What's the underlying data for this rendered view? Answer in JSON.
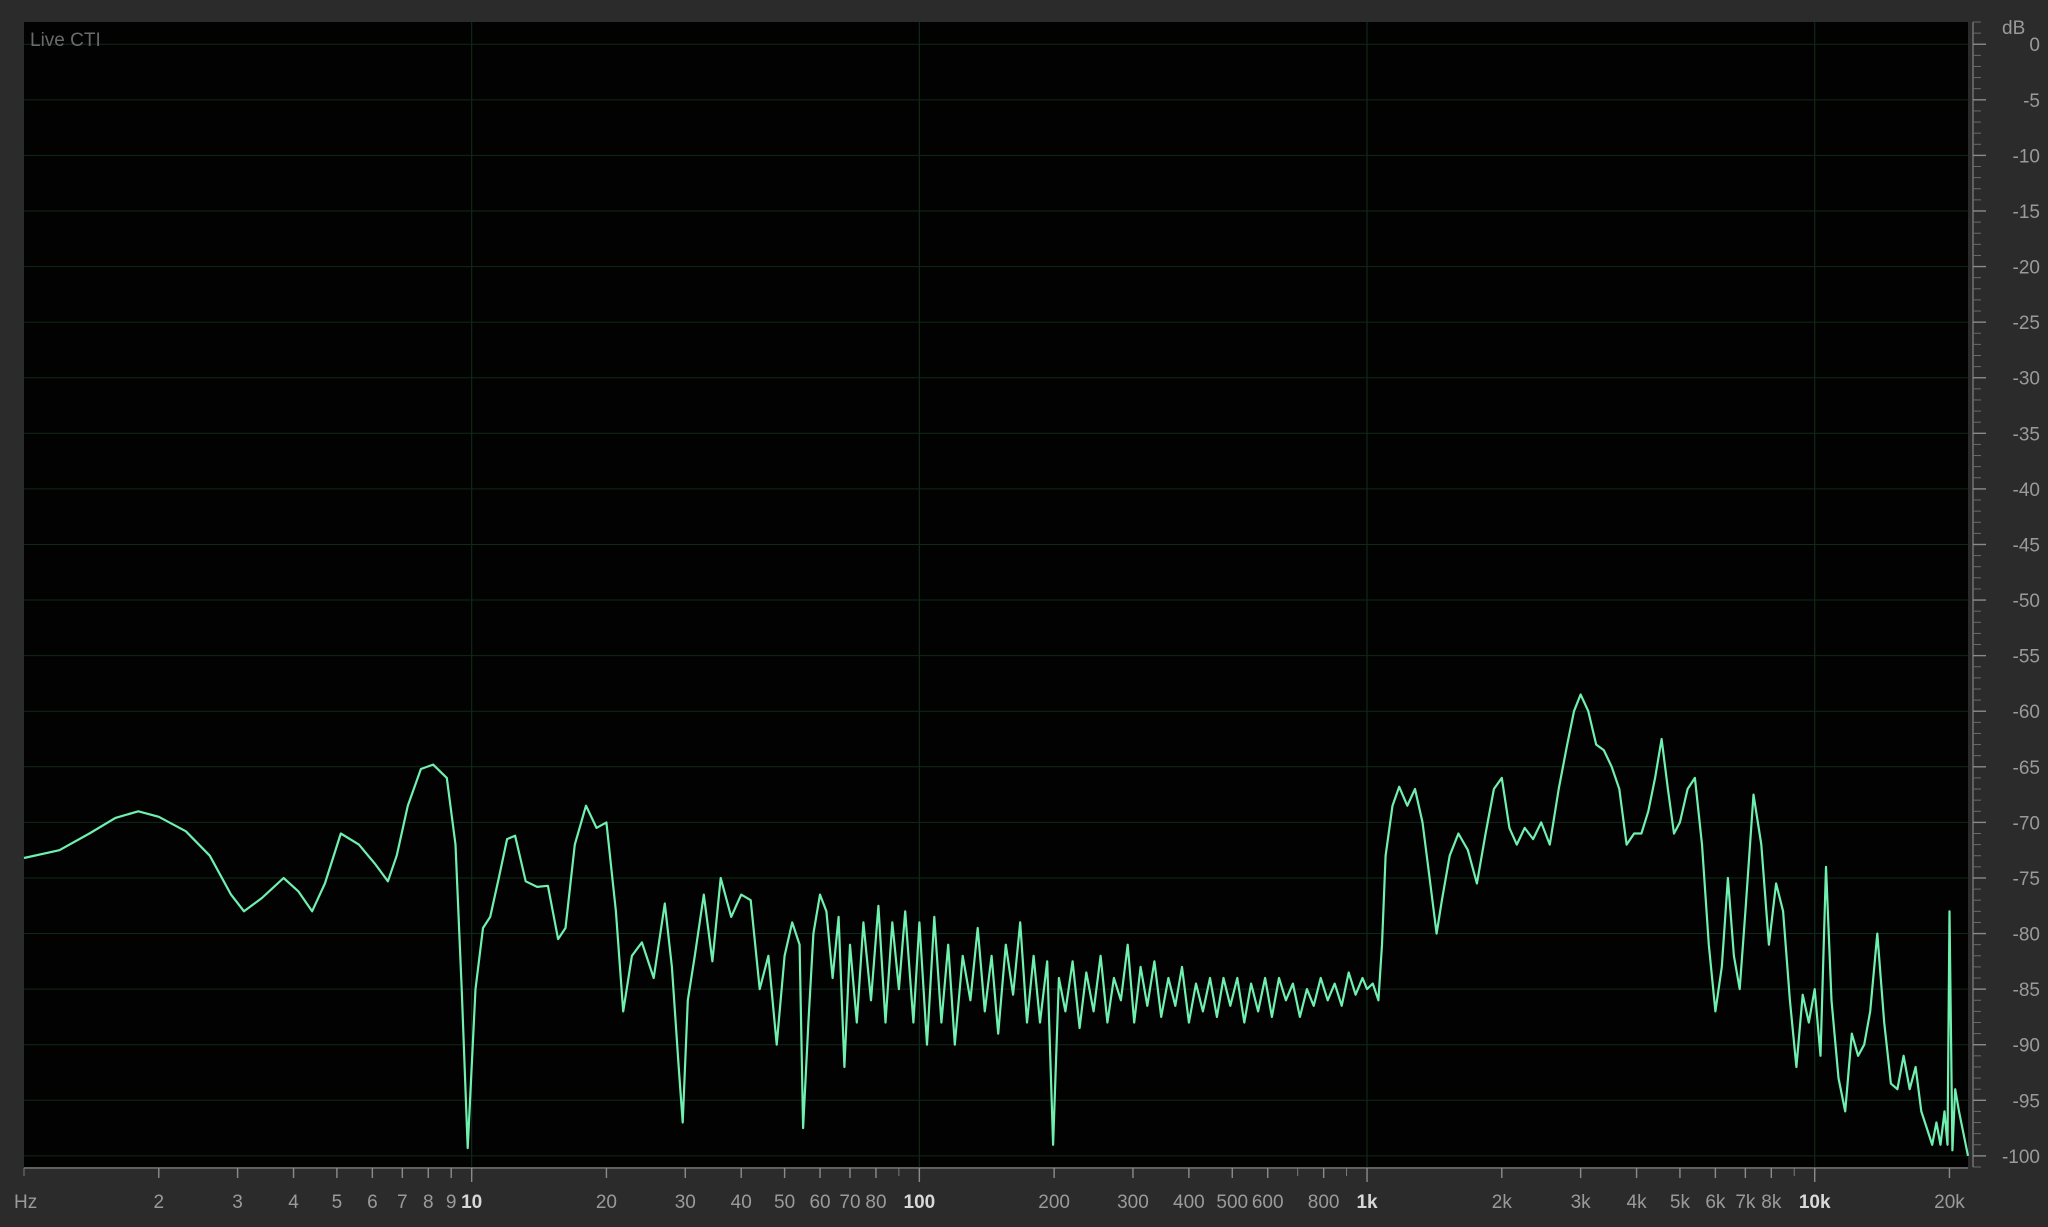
{
  "panel": {
    "title": "Live CTI"
  },
  "colors": {
    "background": "#2b2b2b",
    "plot_bg": "#020202",
    "grid": "#0f2a16",
    "curve": "#6ff0ae",
    "tick_text": "#9a9a9a",
    "tick_text_bold": "#d8d8d8",
    "title_text": "#6a6a6a"
  },
  "chart_data": {
    "type": "line",
    "xscale": "log",
    "xunit": "Hz",
    "yunit": "dB",
    "xlim": [
      1,
      22000
    ],
    "ylim": [
      -101,
      2
    ],
    "grid": true,
    "x_tick_labels": [
      {
        "v": 2,
        "t": "2"
      },
      {
        "v": 3,
        "t": "3"
      },
      {
        "v": 4,
        "t": "4"
      },
      {
        "v": 5,
        "t": "5"
      },
      {
        "v": 6,
        "t": "6"
      },
      {
        "v": 7,
        "t": "7"
      },
      {
        "v": 8,
        "t": "8"
      },
      {
        "v": 9,
        "t": "9"
      },
      {
        "v": 10,
        "t": "10",
        "bold": true
      },
      {
        "v": 20,
        "t": "20"
      },
      {
        "v": 30,
        "t": "30"
      },
      {
        "v": 40,
        "t": "40"
      },
      {
        "v": 50,
        "t": "50"
      },
      {
        "v": 60,
        "t": "60"
      },
      {
        "v": 70,
        "t": "70"
      },
      {
        "v": 80,
        "t": "80"
      },
      {
        "v": 100,
        "t": "100",
        "bold": true
      },
      {
        "v": 200,
        "t": "200"
      },
      {
        "v": 300,
        "t": "300"
      },
      {
        "v": 400,
        "t": "400"
      },
      {
        "v": 500,
        "t": "500"
      },
      {
        "v": 600,
        "t": "600"
      },
      {
        "v": 800,
        "t": "800"
      },
      {
        "v": 1000,
        "t": "1k",
        "bold": true
      },
      {
        "v": 2000,
        "t": "2k"
      },
      {
        "v": 3000,
        "t": "3k"
      },
      {
        "v": 4000,
        "t": "4k"
      },
      {
        "v": 5000,
        "t": "5k"
      },
      {
        "v": 6000,
        "t": "6k"
      },
      {
        "v": 7000,
        "t": "7k"
      },
      {
        "v": 8000,
        "t": "8k"
      },
      {
        "v": 10000,
        "t": "10k",
        "bold": true
      },
      {
        "v": 20000,
        "t": "20k"
      }
    ],
    "y_ticks": [
      0,
      -5,
      -10,
      -15,
      -20,
      -25,
      -30,
      -35,
      -40,
      -45,
      -50,
      -55,
      -60,
      -65,
      -70,
      -75,
      -80,
      -85,
      -90,
      -95,
      -100
    ],
    "series": [
      {
        "values": [
          [
            1.0,
            -73.2
          ],
          [
            1.2,
            -72.5
          ],
          [
            1.4,
            -71.0
          ],
          [
            1.6,
            -69.6
          ],
          [
            1.8,
            -69.0
          ],
          [
            2.0,
            -69.5
          ],
          [
            2.3,
            -70.8
          ],
          [
            2.6,
            -73.0
          ],
          [
            2.9,
            -76.5
          ],
          [
            3.1,
            -78.0
          ],
          [
            3.4,
            -76.8
          ],
          [
            3.8,
            -75.0
          ],
          [
            4.1,
            -76.2
          ],
          [
            4.4,
            -78.0
          ],
          [
            4.7,
            -75.5
          ],
          [
            5.1,
            -71.0
          ],
          [
            5.6,
            -72.0
          ],
          [
            6.1,
            -73.8
          ],
          [
            6.5,
            -75.3
          ],
          [
            6.8,
            -73.0
          ],
          [
            7.2,
            -68.5
          ],
          [
            7.7,
            -65.2
          ],
          [
            8.2,
            -64.8
          ],
          [
            8.8,
            -66.0
          ],
          [
            9.2,
            -72.0
          ],
          [
            9.5,
            -85.0
          ],
          [
            9.8,
            -99.3
          ],
          [
            10.2,
            -85.0
          ],
          [
            10.6,
            -79.5
          ],
          [
            11.0,
            -78.5
          ],
          [
            11.5,
            -75.0
          ],
          [
            12.0,
            -71.5
          ],
          [
            12.5,
            -71.2
          ],
          [
            13.2,
            -75.3
          ],
          [
            14.0,
            -75.8
          ],
          [
            14.8,
            -75.7
          ],
          [
            15.6,
            -80.5
          ],
          [
            16.2,
            -79.5
          ],
          [
            17.0,
            -72.0
          ],
          [
            18.0,
            -68.5
          ],
          [
            19.0,
            -70.5
          ],
          [
            20.0,
            -70.0
          ],
          [
            21.0,
            -78.0
          ],
          [
            21.8,
            -87.0
          ],
          [
            22.8,
            -82.0
          ],
          [
            24.0,
            -80.8
          ],
          [
            25.5,
            -84.0
          ],
          [
            27.0,
            -77.3
          ],
          [
            28.0,
            -83.0
          ],
          [
            29.0,
            -92.0
          ],
          [
            29.6,
            -97.0
          ],
          [
            30.4,
            -86.0
          ],
          [
            31.5,
            -82.0
          ],
          [
            33.0,
            -76.5
          ],
          [
            34.5,
            -82.5
          ],
          [
            36.0,
            -75.0
          ],
          [
            38.0,
            -78.5
          ],
          [
            40.0,
            -76.5
          ],
          [
            42.0,
            -77.0
          ],
          [
            44.0,
            -85.0
          ],
          [
            46.0,
            -82.0
          ],
          [
            48.0,
            -90.0
          ],
          [
            50.0,
            -82.0
          ],
          [
            52.0,
            -79.0
          ],
          [
            54.0,
            -81.0
          ],
          [
            55.0,
            -97.5
          ],
          [
            56.5,
            -88.0
          ],
          [
            58.0,
            -80.0
          ],
          [
            60.0,
            -76.5
          ],
          [
            62.0,
            -78.0
          ],
          [
            64.0,
            -84.0
          ],
          [
            66.0,
            -78.5
          ],
          [
            68.0,
            -92.0
          ],
          [
            70.0,
            -81.0
          ],
          [
            72.5,
            -88.0
          ],
          [
            75.0,
            -79.0
          ],
          [
            78.0,
            -86.0
          ],
          [
            81.0,
            -77.5
          ],
          [
            84.0,
            -88.0
          ],
          [
            87.0,
            -79.0
          ],
          [
            90.0,
            -85.0
          ],
          [
            93.0,
            -78.0
          ],
          [
            97.0,
            -88.0
          ],
          [
            100.0,
            -79.0
          ],
          [
            104.0,
            -90.0
          ],
          [
            108.0,
            -78.5
          ],
          [
            112.0,
            -88.0
          ],
          [
            116.0,
            -81.0
          ],
          [
            120.0,
            -90.0
          ],
          [
            125.0,
            -82.0
          ],
          [
            130.0,
            -86.0
          ],
          [
            135.0,
            -79.5
          ],
          [
            140.0,
            -87.0
          ],
          [
            145.0,
            -82.0
          ],
          [
            150.0,
            -89.0
          ],
          [
            156.0,
            -81.0
          ],
          [
            162.0,
            -85.5
          ],
          [
            168.0,
            -79.0
          ],
          [
            174.0,
            -88.0
          ],
          [
            180.0,
            -82.0
          ],
          [
            186.0,
            -88.0
          ],
          [
            193.0,
            -82.5
          ],
          [
            199.0,
            -99.0
          ],
          [
            205.0,
            -84.0
          ],
          [
            212.0,
            -87.0
          ],
          [
            220.0,
            -82.5
          ],
          [
            228.0,
            -88.5
          ],
          [
            236.0,
            -83.5
          ],
          [
            245.0,
            -87.0
          ],
          [
            254.0,
            -82.0
          ],
          [
            263.0,
            -88.0
          ],
          [
            272.0,
            -84.0
          ],
          [
            282.0,
            -86.0
          ],
          [
            292.0,
            -81.0
          ],
          [
            302.0,
            -88.0
          ],
          [
            312.0,
            -83.0
          ],
          [
            323.0,
            -86.5
          ],
          [
            335.0,
            -82.5
          ],
          [
            347.0,
            -87.5
          ],
          [
            360.0,
            -84.0
          ],
          [
            373.0,
            -86.5
          ],
          [
            386.0,
            -83.0
          ],
          [
            400.0,
            -88.0
          ],
          [
            415.0,
            -84.5
          ],
          [
            430.0,
            -87.0
          ],
          [
            446.0,
            -84.0
          ],
          [
            462.0,
            -87.5
          ],
          [
            478.0,
            -84.0
          ],
          [
            495.0,
            -86.5
          ],
          [
            513.0,
            -84.0
          ],
          [
            532.0,
            -88.0
          ],
          [
            551.0,
            -84.5
          ],
          [
            571.0,
            -87.0
          ],
          [
            592.0,
            -84.0
          ],
          [
            613.0,
            -87.5
          ],
          [
            636.0,
            -84.0
          ],
          [
            659.0,
            -86.0
          ],
          [
            683.0,
            -84.5
          ],
          [
            708.0,
            -87.5
          ],
          [
            734.0,
            -85.0
          ],
          [
            760.0,
            -86.5
          ],
          [
            788.0,
            -84.0
          ],
          [
            817.0,
            -86.0
          ],
          [
            847.0,
            -84.5
          ],
          [
            878.0,
            -86.5
          ],
          [
            910.0,
            -83.5
          ],
          [
            943.0,
            -85.5
          ],
          [
            977.0,
            -84.0
          ],
          [
            1000.0,
            -85.0
          ],
          [
            1030.0,
            -84.5
          ],
          [
            1060.0,
            -86.0
          ],
          [
            1080.0,
            -81.0
          ],
          [
            1100.0,
            -73.0
          ],
          [
            1140.0,
            -68.5
          ],
          [
            1180.0,
            -66.8
          ],
          [
            1230.0,
            -68.5
          ],
          [
            1280.0,
            -67.0
          ],
          [
            1330.0,
            -70.0
          ],
          [
            1380.0,
            -75.0
          ],
          [
            1430.0,
            -80.0
          ],
          [
            1470.0,
            -77.0
          ],
          [
            1530.0,
            -73.0
          ],
          [
            1600.0,
            -71.0
          ],
          [
            1680.0,
            -72.5
          ],
          [
            1760.0,
            -75.5
          ],
          [
            1840.0,
            -71.0
          ],
          [
            1920.0,
            -67.0
          ],
          [
            2000.0,
            -66.0
          ],
          [
            2080.0,
            -70.5
          ],
          [
            2160.0,
            -72.0
          ],
          [
            2250.0,
            -70.5
          ],
          [
            2350.0,
            -71.5
          ],
          [
            2450.0,
            -70.0
          ],
          [
            2560.0,
            -72.0
          ],
          [
            2680.0,
            -67.0
          ],
          [
            2800.0,
            -63.0
          ],
          [
            2900.0,
            -60.0
          ],
          [
            3000.0,
            -58.5
          ],
          [
            3120.0,
            -60.0
          ],
          [
            3250.0,
            -63.0
          ],
          [
            3380.0,
            -63.5
          ],
          [
            3520.0,
            -65.0
          ],
          [
            3660.0,
            -67.0
          ],
          [
            3800.0,
            -72.0
          ],
          [
            3950.0,
            -71.0
          ],
          [
            4100.0,
            -71.0
          ],
          [
            4250.0,
            -69.0
          ],
          [
            4400.0,
            -66.0
          ],
          [
            4550.0,
            -62.5
          ],
          [
            4700.0,
            -67.0
          ],
          [
            4850.0,
            -71.0
          ],
          [
            5000.0,
            -70.0
          ],
          [
            5200.0,
            -67.0
          ],
          [
            5400.0,
            -66.0
          ],
          [
            5600.0,
            -72.0
          ],
          [
            5800.0,
            -81.0
          ],
          [
            6000.0,
            -87.0
          ],
          [
            6200.0,
            -83.0
          ],
          [
            6400.0,
            -75.0
          ],
          [
            6600.0,
            -82.0
          ],
          [
            6800.0,
            -85.0
          ],
          [
            7000.0,
            -78.0
          ],
          [
            7300.0,
            -67.5
          ],
          [
            7600.0,
            -72.0
          ],
          [
            7900.0,
            -81.0
          ],
          [
            8200.0,
            -75.5
          ],
          [
            8500.0,
            -78.0
          ],
          [
            8800.0,
            -86.0
          ],
          [
            9100.0,
            -92.0
          ],
          [
            9400.0,
            -85.5
          ],
          [
            9700.0,
            -88.0
          ],
          [
            10000.0,
            -85.0
          ],
          [
            10300.0,
            -91.0
          ],
          [
            10600.0,
            -74.0
          ],
          [
            10900.0,
            -86.0
          ],
          [
            11300.0,
            -93.0
          ],
          [
            11700.0,
            -96.0
          ],
          [
            12100.0,
            -89.0
          ],
          [
            12500.0,
            -91.0
          ],
          [
            12900.0,
            -90.0
          ],
          [
            13300.0,
            -87.0
          ],
          [
            13800.0,
            -80.0
          ],
          [
            14300.0,
            -88.0
          ],
          [
            14800.0,
            -93.5
          ],
          [
            15300.0,
            -94.0
          ],
          [
            15800.0,
            -91.0
          ],
          [
            16300.0,
            -94.0
          ],
          [
            16800.0,
            -92.0
          ],
          [
            17300.0,
            -96.0
          ],
          [
            17800.0,
            -97.5
          ],
          [
            18300.0,
            -99.0
          ],
          [
            18700.0,
            -97.0
          ],
          [
            19100.0,
            -99.0
          ],
          [
            19500.0,
            -96.0
          ],
          [
            19800.0,
            -99.0
          ],
          [
            20000.0,
            -78.0
          ],
          [
            20300.0,
            -99.5
          ],
          [
            20600.0,
            -94.0
          ],
          [
            21000.0,
            -96.0
          ],
          [
            21500.0,
            -98.0
          ],
          [
            22000.0,
            -100.0
          ]
        ]
      }
    ]
  }
}
